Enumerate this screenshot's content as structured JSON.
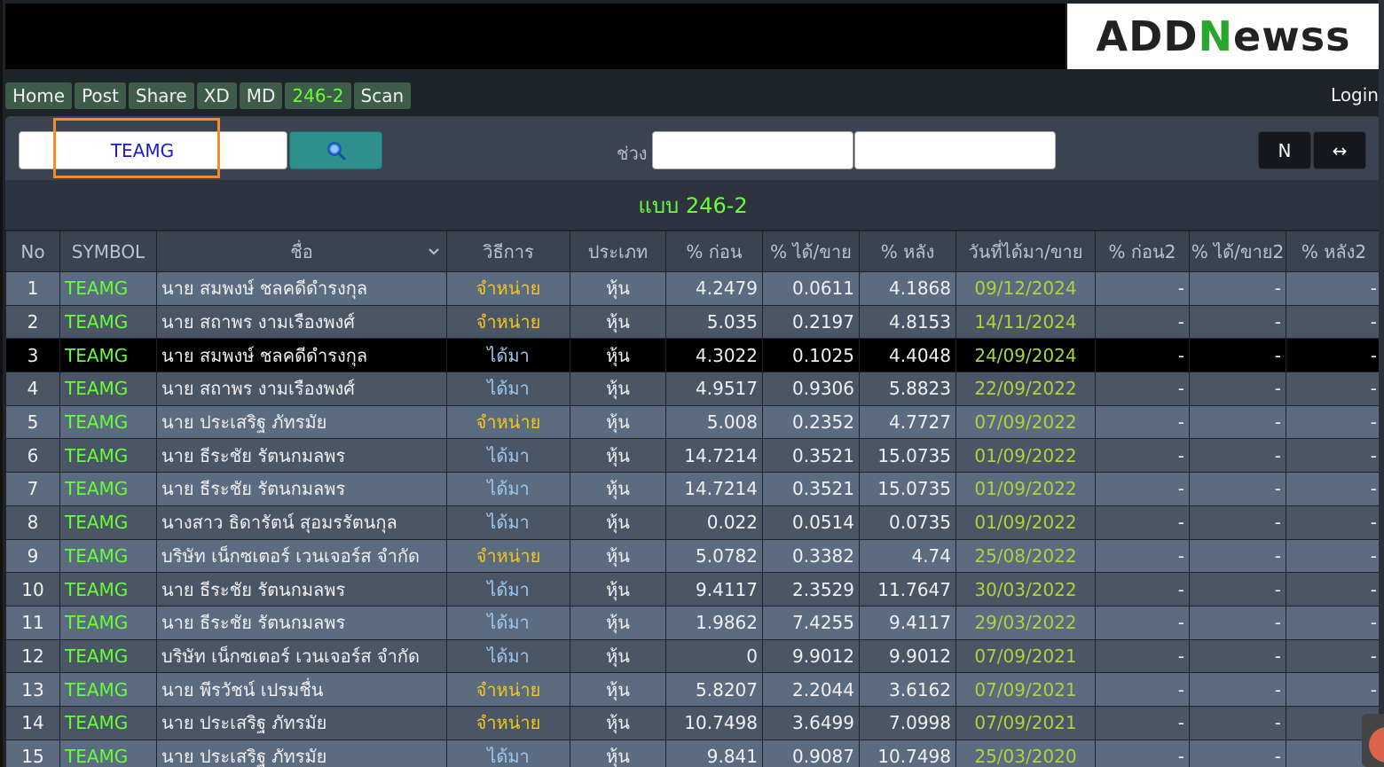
{
  "brand": {
    "logo_a": "ADD",
    "logo_b": "N",
    "logo_c": "ewss"
  },
  "nav": {
    "items": [
      {
        "label": "Home"
      },
      {
        "label": "Post"
      },
      {
        "label": "Share"
      },
      {
        "label": "XD"
      },
      {
        "label": "MD"
      },
      {
        "label": "246-2",
        "active": true
      },
      {
        "label": "Scan"
      }
    ],
    "login": "Login"
  },
  "search": {
    "value": "TEAMG",
    "range_label": "ช่วง",
    "range_start": "",
    "range_end": "",
    "n_label": "N",
    "expand_label": "↔"
  },
  "pattern_title": "แบบ 246-2",
  "table": {
    "headers": [
      "No",
      "SYMBOL",
      "ชื่อ",
      "วิธีการ",
      "ประเภท",
      "% ก่อน",
      "% ได้/ขาย",
      "% หลัง",
      "วันที่ได้มา/ขาย",
      "% ก่อน2",
      "% ได้/ขาย2",
      "% หลัง2"
    ],
    "rows": [
      {
        "no": "1",
        "symbol": "TEAMG",
        "name": "นาย สมพงษ์ ชลคดีดำรงกุล",
        "method": "จำหน่าย",
        "type": "หุ้น",
        "before": "4.2479",
        "change": "0.0611",
        "after": "4.1868",
        "date": "09/12/2024",
        "before2": "-",
        "change2": "-",
        "after2": "-"
      },
      {
        "no": "2",
        "symbol": "TEAMG",
        "name": "นาย สถาพร งามเรืองพงศ์",
        "method": "จำหน่าย",
        "type": "หุ้น",
        "before": "5.035",
        "change": "0.2197",
        "after": "4.8153",
        "date": "14/11/2024",
        "before2": "-",
        "change2": "-",
        "after2": "-"
      },
      {
        "no": "3",
        "symbol": "TEAMG",
        "name": "นาย สมพงษ์ ชลคดีดำรงกุล",
        "method": "ได้มา",
        "type": "หุ้น",
        "before": "4.3022",
        "change": "0.1025",
        "after": "4.4048",
        "date": "24/09/2024",
        "before2": "-",
        "change2": "-",
        "after2": "-"
      },
      {
        "no": "4",
        "symbol": "TEAMG",
        "name": "นาย สถาพร งามเรืองพงศ์",
        "method": "ได้มา",
        "type": "หุ้น",
        "before": "4.9517",
        "change": "0.9306",
        "after": "5.8823",
        "date": "22/09/2022",
        "before2": "-",
        "change2": "-",
        "after2": "-"
      },
      {
        "no": "5",
        "symbol": "TEAMG",
        "name": "นาย ประเสริฐ ภัทรมัย",
        "method": "จำหน่าย",
        "type": "หุ้น",
        "before": "5.008",
        "change": "0.2352",
        "after": "4.7727",
        "date": "07/09/2022",
        "before2": "-",
        "change2": "-",
        "after2": "-"
      },
      {
        "no": "6",
        "symbol": "TEAMG",
        "name": "นาย ธีระชัย รัตนกมลพร",
        "method": "ได้มา",
        "type": "หุ้น",
        "before": "14.7214",
        "change": "0.3521",
        "after": "15.0735",
        "date": "01/09/2022",
        "before2": "-",
        "change2": "-",
        "after2": "-"
      },
      {
        "no": "7",
        "symbol": "TEAMG",
        "name": "นาย ธีระชัย รัตนกมลพร",
        "method": "ได้มา",
        "type": "หุ้น",
        "before": "14.7214",
        "change": "0.3521",
        "after": "15.0735",
        "date": "01/09/2022",
        "before2": "-",
        "change2": "-",
        "after2": "-"
      },
      {
        "no": "8",
        "symbol": "TEAMG",
        "name": "นางสาว ธิดารัตน์ สุอมรรัตนกุล",
        "method": "ได้มา",
        "type": "หุ้น",
        "before": "0.022",
        "change": "0.0514",
        "after": "0.0735",
        "date": "01/09/2022",
        "before2": "-",
        "change2": "-",
        "after2": "-"
      },
      {
        "no": "9",
        "symbol": "TEAMG",
        "name": "บริษัท เน็กซเตอร์ เวนเจอร์ส จำกัด",
        "method": "จำหน่าย",
        "type": "หุ้น",
        "before": "5.0782",
        "change": "0.3382",
        "after": "4.74",
        "date": "25/08/2022",
        "before2": "-",
        "change2": "-",
        "after2": "-"
      },
      {
        "no": "10",
        "symbol": "TEAMG",
        "name": "นาย ธีระชัย รัตนกมลพร",
        "method": "ได้มา",
        "type": "หุ้น",
        "before": "9.4117",
        "change": "2.3529",
        "after": "11.7647",
        "date": "30/03/2022",
        "before2": "-",
        "change2": "-",
        "after2": "-"
      },
      {
        "no": "11",
        "symbol": "TEAMG",
        "name": "นาย ธีระชัย รัตนกมลพร",
        "method": "ได้มา",
        "type": "หุ้น",
        "before": "1.9862",
        "change": "7.4255",
        "after": "9.4117",
        "date": "29/03/2022",
        "before2": "-",
        "change2": "-",
        "after2": "-"
      },
      {
        "no": "12",
        "symbol": "TEAMG",
        "name": "บริษัท เน็กซเตอร์ เวนเจอร์ส จำกัด",
        "method": "ได้มา",
        "type": "หุ้น",
        "before": "0",
        "change": "9.9012",
        "after": "9.9012",
        "date": "07/09/2021",
        "before2": "-",
        "change2": "-",
        "after2": "-"
      },
      {
        "no": "13",
        "symbol": "TEAMG",
        "name": "นาย พีรวัชน์ เปรมชื่น",
        "method": "จำหน่าย",
        "type": "หุ้น",
        "before": "5.8207",
        "change": "2.2044",
        "after": "3.6162",
        "date": "07/09/2021",
        "before2": "-",
        "change2": "-",
        "after2": "-"
      },
      {
        "no": "14",
        "symbol": "TEAMG",
        "name": "นาย ประเสริฐ ภัทรมัย",
        "method": "จำหน่าย",
        "type": "หุ้น",
        "before": "10.7498",
        "change": "3.6499",
        "after": "7.0998",
        "date": "07/09/2021",
        "before2": "-",
        "change2": "-",
        "after2": "-"
      },
      {
        "no": "15",
        "symbol": "TEAMG",
        "name": "นาย ประเสริฐ ภัทรมัย",
        "method": "ได้มา",
        "type": "หุ้น",
        "before": "9.841",
        "change": "0.9087",
        "after": "10.7498",
        "date": "25/03/2020",
        "before2": "-",
        "change2": "-",
        "after2": "-"
      }
    ],
    "selected_row": 3
  },
  "colors": {
    "accent_green": "#66ff33",
    "sell_yellow": "#f5c518",
    "buy_blue": "#9ec8ef",
    "date_green": "#a8d63a",
    "highlight_orange": "#f58b2b"
  }
}
